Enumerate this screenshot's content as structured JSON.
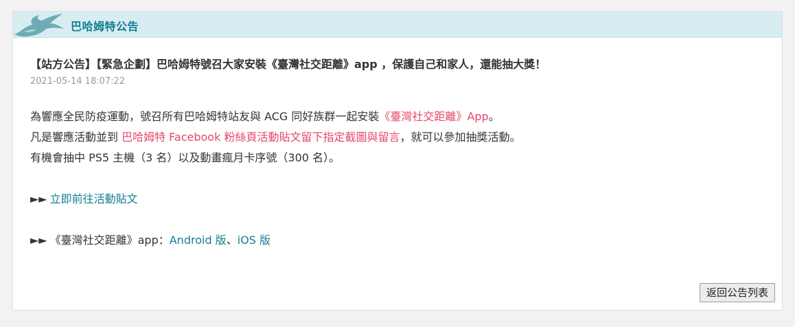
{
  "header": {
    "title": "巴哈姆特公告",
    "logo_icon": "dragon-logo-icon"
  },
  "article": {
    "title": "【站方公告】【緊急企劃】巴哈姆特號召大家安裝《臺灣社交距離》app ，保護自己和家人，還能抽大獎！",
    "date": "2021-05-14 18:07:22",
    "body": {
      "line1_prefix": "為響應全民防疫運動，號召所有巴哈姆特站友與 ACG 同好族群一起安裝",
      "line1_highlight": "《臺灣社交距離》App",
      "line1_suffix": "。",
      "line2_prefix": "凡是響應活動並到 ",
      "line2_highlight": "巴哈姆特 Facebook 粉絲頁活動貼文留下指定截圖與留言",
      "line2_suffix": "，就可以參加抽獎活動。",
      "line3": "有機會抽中 PS5 主機（3 名）以及動畫瘋月卡序號（300 名）。"
    },
    "links": {
      "arrows": "►►",
      "event_link": "立即前往活動貼文",
      "app_prefix": "《臺灣社交距離》app：",
      "android_link": "Android 版",
      "separator": "、",
      "ios_link": "iOS 版"
    }
  },
  "footer": {
    "back_button": "返回公告列表"
  },
  "colors": {
    "accent": "#0f7d92",
    "highlight": "#e6476a",
    "header_bg": "#d8edf1"
  }
}
